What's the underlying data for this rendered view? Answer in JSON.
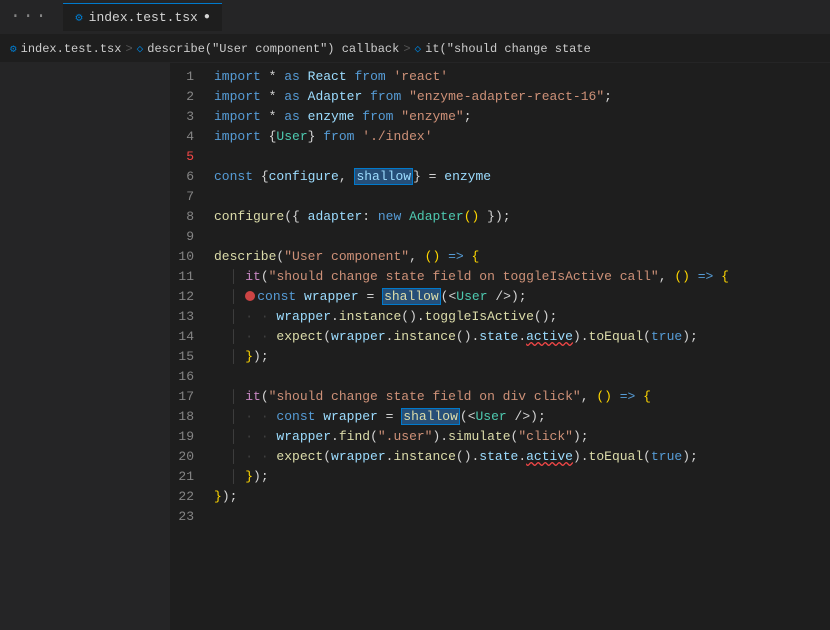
{
  "titlebar": {
    "dots": "···",
    "tab_icon": "⚙",
    "tab_name": "index.test.tsx",
    "tab_dot": "●"
  },
  "breadcrumb": {
    "file_icon": "⚙",
    "file": "index.test.tsx",
    "sep1": ">",
    "cb_icon": "◇",
    "cb_text": "describe(\"User component\") callback",
    "sep2": ">",
    "it_icon": "◇",
    "it_text": "it(\"should change state"
  },
  "lines": [
    {
      "num": 1,
      "tokens": "import_react"
    },
    {
      "num": 2,
      "tokens": "import_adapter"
    },
    {
      "num": 3,
      "tokens": "import_enzyme"
    },
    {
      "num": 4,
      "tokens": "import_user"
    },
    {
      "num": 5,
      "tokens": "empty",
      "error": true
    },
    {
      "num": 6,
      "tokens": "const_configure"
    },
    {
      "num": 7,
      "tokens": "empty"
    },
    {
      "num": 8,
      "tokens": "configure"
    },
    {
      "num": 9,
      "tokens": "empty"
    },
    {
      "num": 10,
      "tokens": "describe_start"
    },
    {
      "num": 11,
      "tokens": "it_start"
    },
    {
      "num": 12,
      "tokens": "const_wrapper_1"
    },
    {
      "num": 13,
      "tokens": "wrapper_instance_toggle"
    },
    {
      "num": 14,
      "tokens": "expect_instance_state"
    },
    {
      "num": 15,
      "tokens": "close_brace_1"
    },
    {
      "num": 16,
      "tokens": "empty"
    },
    {
      "num": 17,
      "tokens": "it_start_2"
    },
    {
      "num": 18,
      "tokens": "const_wrapper_2"
    },
    {
      "num": 19,
      "tokens": "wrapper_find"
    },
    {
      "num": 20,
      "tokens": "expect_instance_state_2"
    },
    {
      "num": 21,
      "tokens": "close_brace_2"
    },
    {
      "num": 22,
      "tokens": "close_describe"
    },
    {
      "num": 23,
      "tokens": "empty"
    }
  ]
}
